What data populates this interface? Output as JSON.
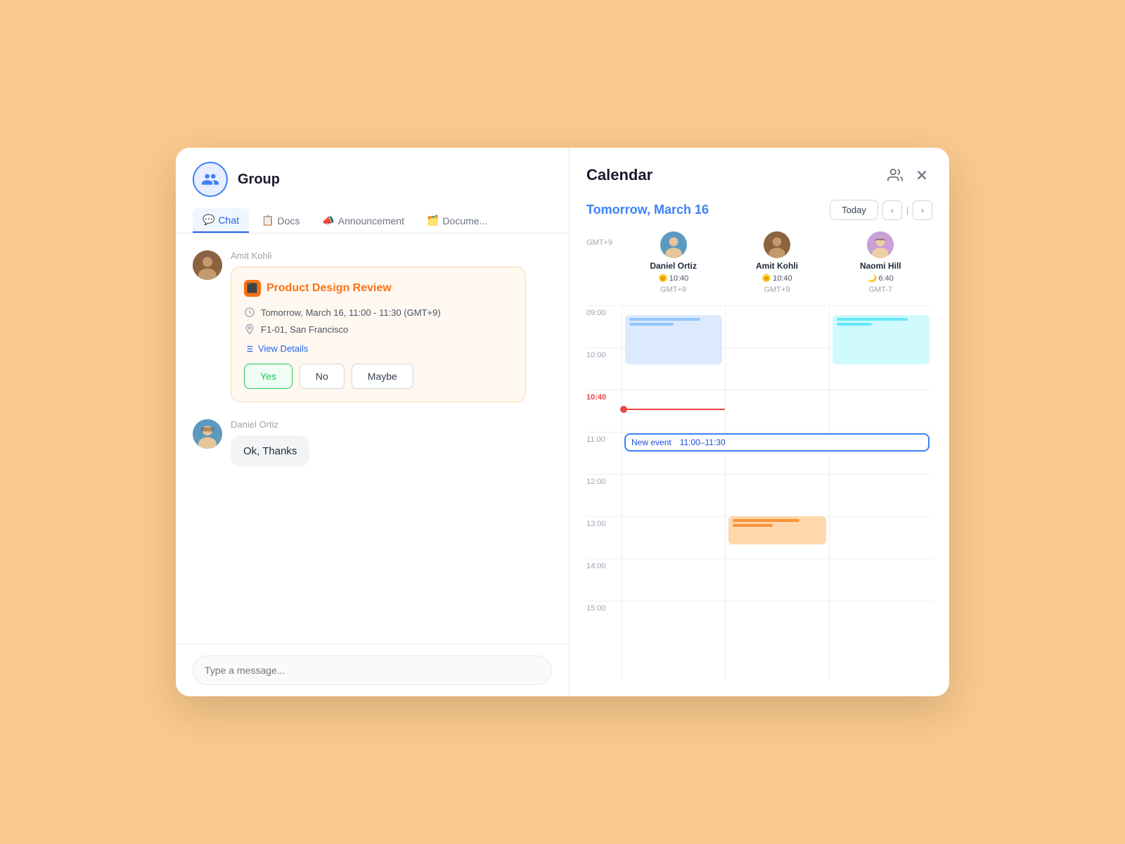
{
  "app": {
    "bg": "#f9c98d"
  },
  "left": {
    "group": {
      "title": "Group",
      "avatar_icon": "people"
    },
    "tabs": [
      {
        "id": "chat",
        "label": "Chat",
        "icon": "💬",
        "active": true
      },
      {
        "id": "docs",
        "label": "Docs",
        "icon": "📋",
        "active": false
      },
      {
        "id": "announcement",
        "label": "Announcement",
        "icon": "📣",
        "active": false
      },
      {
        "id": "documents",
        "label": "Docume...",
        "icon": "🗂️",
        "active": false
      }
    ],
    "messages": [
      {
        "id": "msg1",
        "sender": "Amit Kohli",
        "avatar_type": "amit",
        "type": "event",
        "event": {
          "title": "Product Design Review",
          "datetime": "Tomorrow, March 16, 11:00 - 11:30 (GMT+9)",
          "location": "F1-01, San Francisco",
          "view_details": "View Details",
          "rsvp": {
            "yes": "Yes",
            "no": "No",
            "maybe": "Maybe"
          }
        }
      },
      {
        "id": "msg2",
        "sender": "Daniel Ortiz",
        "avatar_type": "daniel",
        "type": "text",
        "text": "Ok, Thanks"
      }
    ],
    "input_placeholder": "Type a message..."
  },
  "right": {
    "title": "Calendar",
    "date_label": "Tomorrow, March 16",
    "today_btn": "Today",
    "people": [
      {
        "name": "Daniel Ortiz",
        "avatar_type": "daniel",
        "time": "🌞 10:40",
        "tz": "GMT+9",
        "emoji": "🌞"
      },
      {
        "name": "Amit Kohli",
        "avatar_type": "amit",
        "time": "🌞 10:40",
        "tz": "GMT+9",
        "emoji": "🌞"
      },
      {
        "name": "Naomi Hill",
        "avatar_type": "naomi",
        "time": "🌙 6:40",
        "tz": "GMT-7",
        "emoji": "🌙"
      }
    ],
    "time_slots": [
      "09:00",
      "10:00",
      "10:40",
      "11:00",
      "12:00",
      "13:00",
      "14:00",
      "15:00"
    ],
    "current_time": "10:40",
    "new_event": {
      "label": "New event",
      "time": "11:00–11:30"
    }
  }
}
